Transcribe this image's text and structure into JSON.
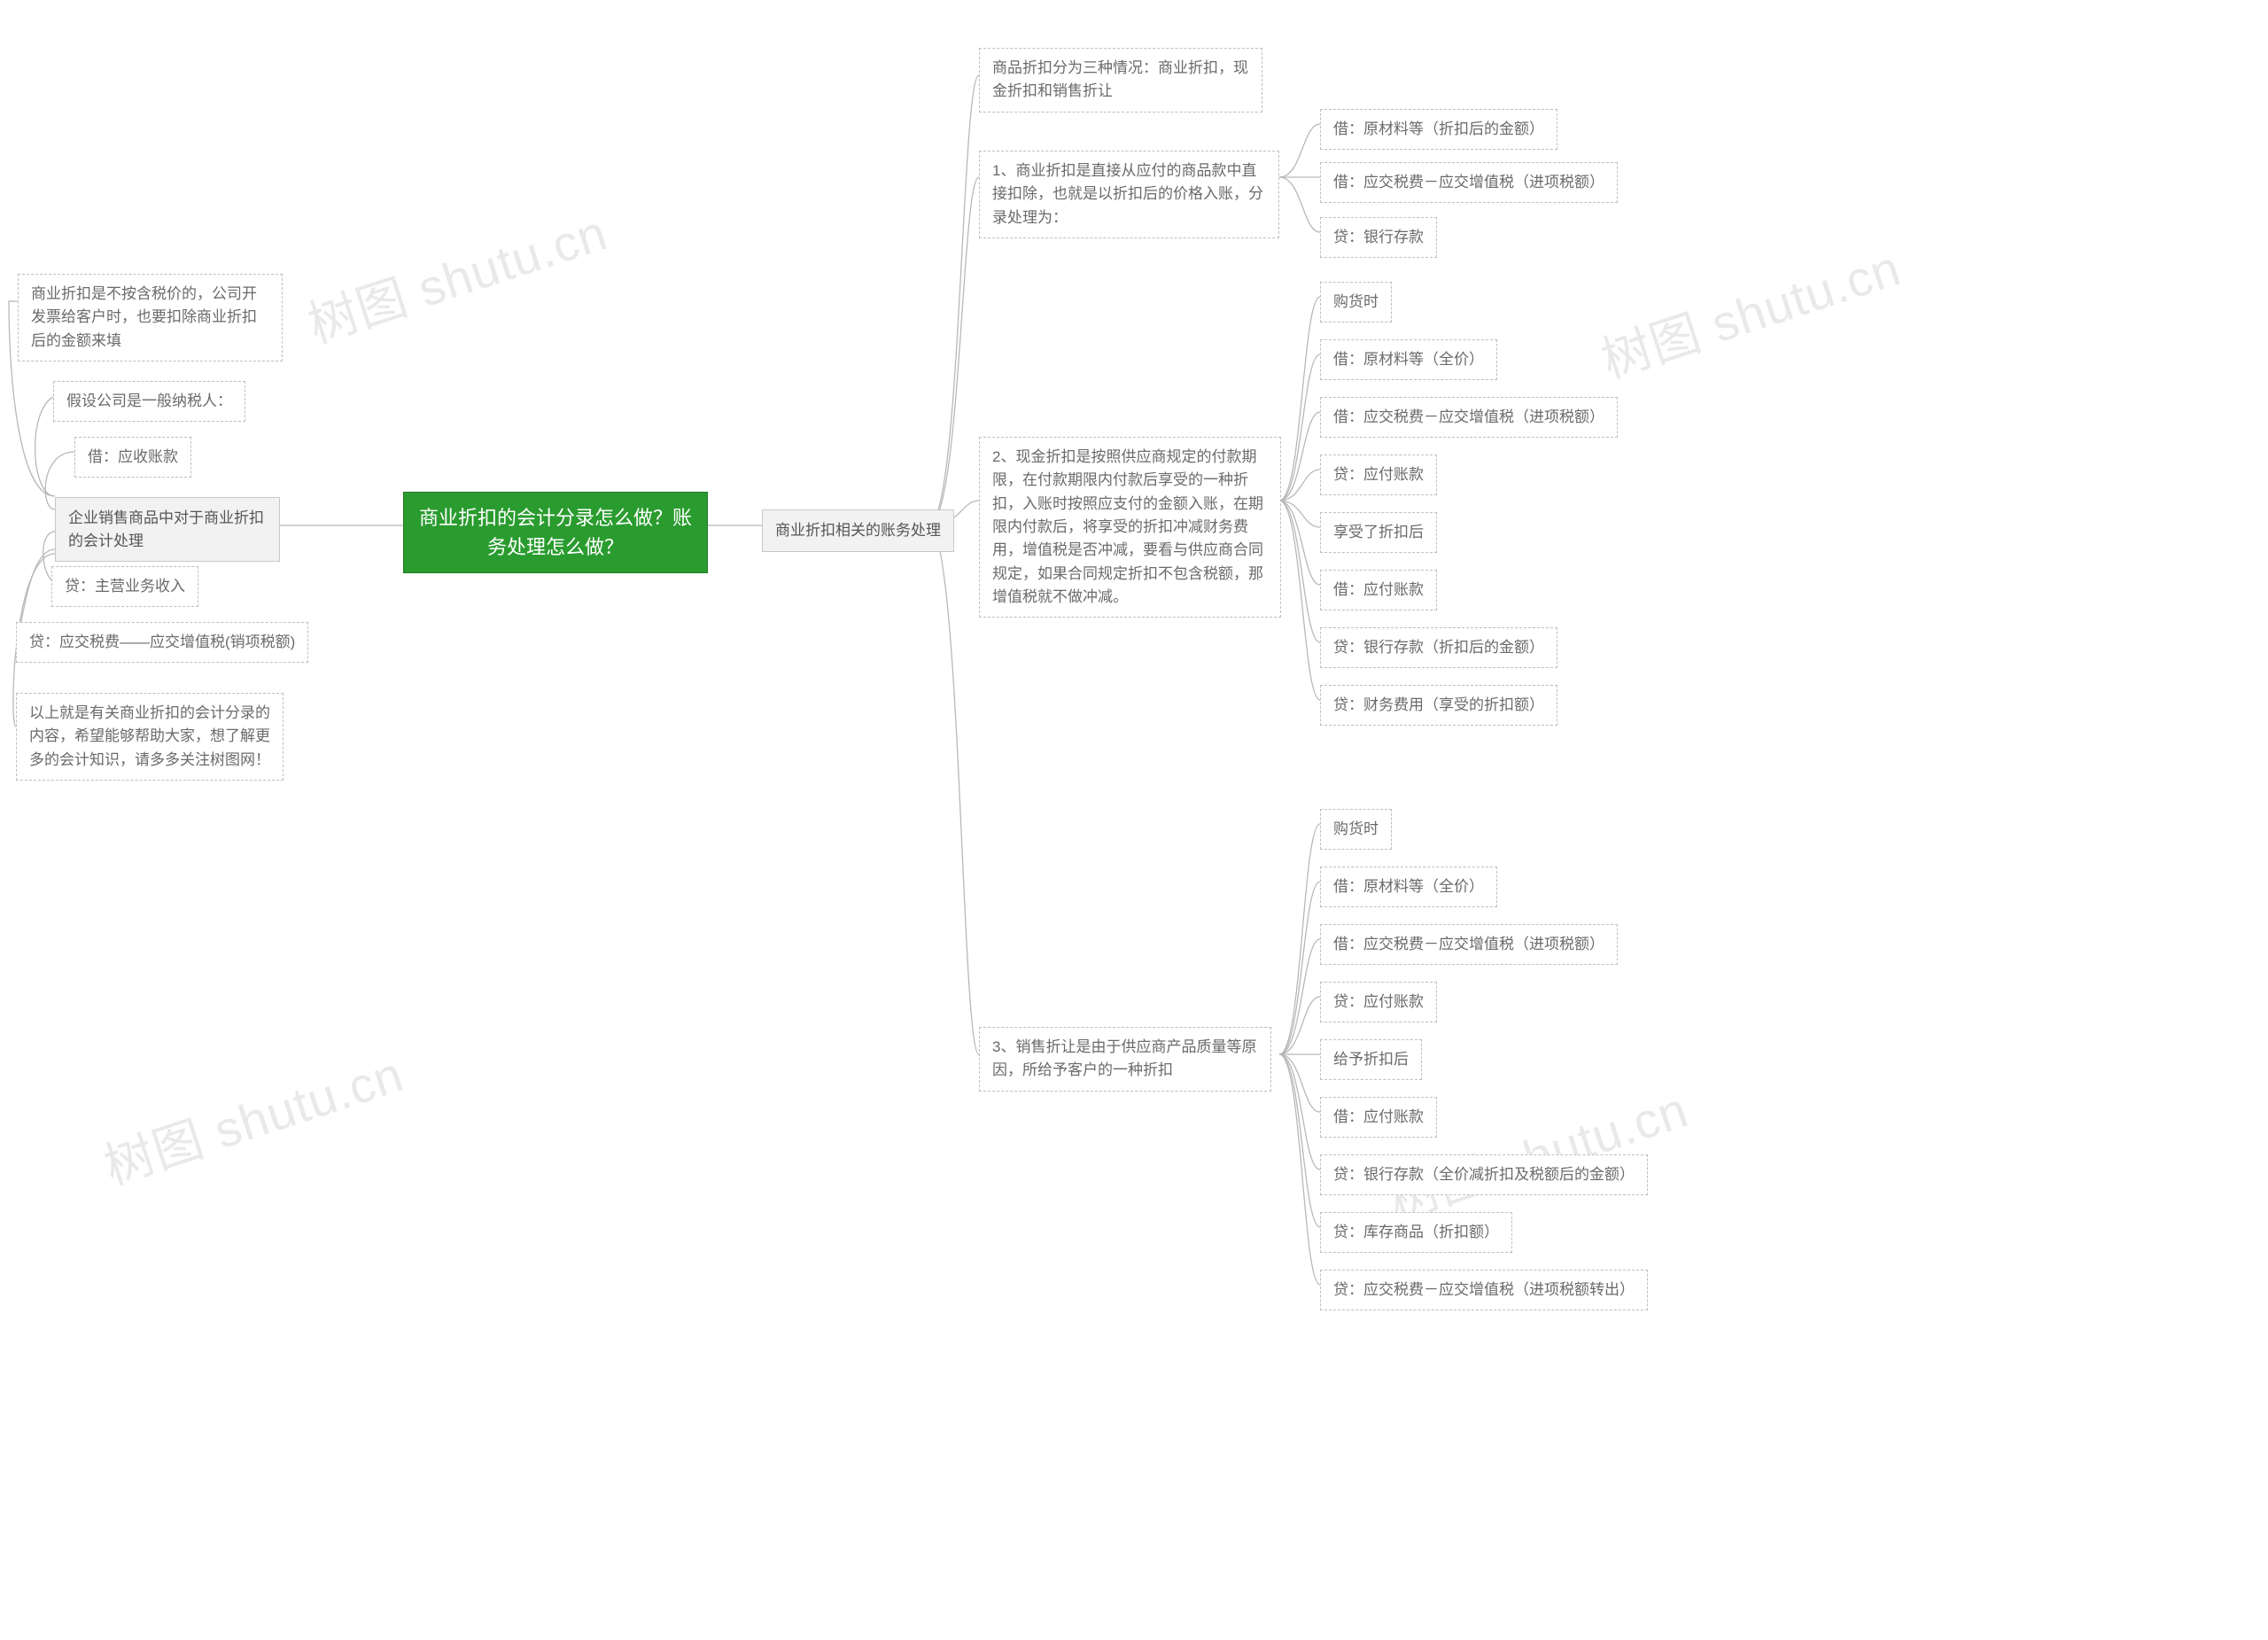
{
  "watermark": "树图 shutu.cn",
  "root": "商业折扣的会计分录怎么做？账务处理怎么做？",
  "left": {
    "title": "企业销售商品中对于商业折扣的会计处理",
    "items": [
      "商业折扣是不按含税价的，公司开发票给客户时，也要扣除商业折扣后的金额来填",
      "假设公司是一般纳税人：",
      "借：应收账款",
      "贷：主营业务收入",
      "贷：应交税费——应交增值税(销项税额)",
      "以上就是有关商业折扣的会计分录的内容，希望能够帮助大家，想了解更多的会计知识，请多多关注树图网！"
    ]
  },
  "right": {
    "title": "商业折扣相关的账务处理",
    "sub0": "商品折扣分为三种情况：商业折扣，现金折扣和销售折让",
    "sub1": {
      "label": "1、商业折扣是直接从应付的商品款中直接扣除，也就是以折扣后的价格入账，分录处理为：",
      "items": [
        "借：原材料等（折扣后的金额）",
        "借：应交税费－应交增值税（进项税额）",
        "贷：银行存款"
      ]
    },
    "sub2": {
      "label": "2、现金折扣是按照供应商规定的付款期限，在付款期限内付款后享受的一种折扣，入账时按照应支付的金额入账，在期限内付款后，将享受的折扣冲减财务费用，增值税是否冲减，要看与供应商合同规定，如果合同规定折扣不包含税额，那增值税就不做冲减。",
      "items": [
        "购货时",
        "借：原材料等（全价）",
        "借：应交税费－应交增值税（进项税额）",
        "贷：应付账款",
        "享受了折扣后",
        "借：应付账款",
        "贷：银行存款（折扣后的金额）",
        "贷：财务费用（享受的折扣额）"
      ]
    },
    "sub3": {
      "label": "3、销售折让是由于供应商产品质量等原因，所给予客户的一种折扣",
      "items": [
        "购货时",
        "借：原材料等（全价）",
        "借：应交税费－应交增值税（进项税额）",
        "贷：应付账款",
        "给予折扣后",
        "借：应付账款",
        "贷：银行存款（全价减折扣及税额后的金额）",
        "贷：库存商品（折扣额）",
        "贷：应交税费－应交增值税（进项税额转出）"
      ]
    }
  }
}
